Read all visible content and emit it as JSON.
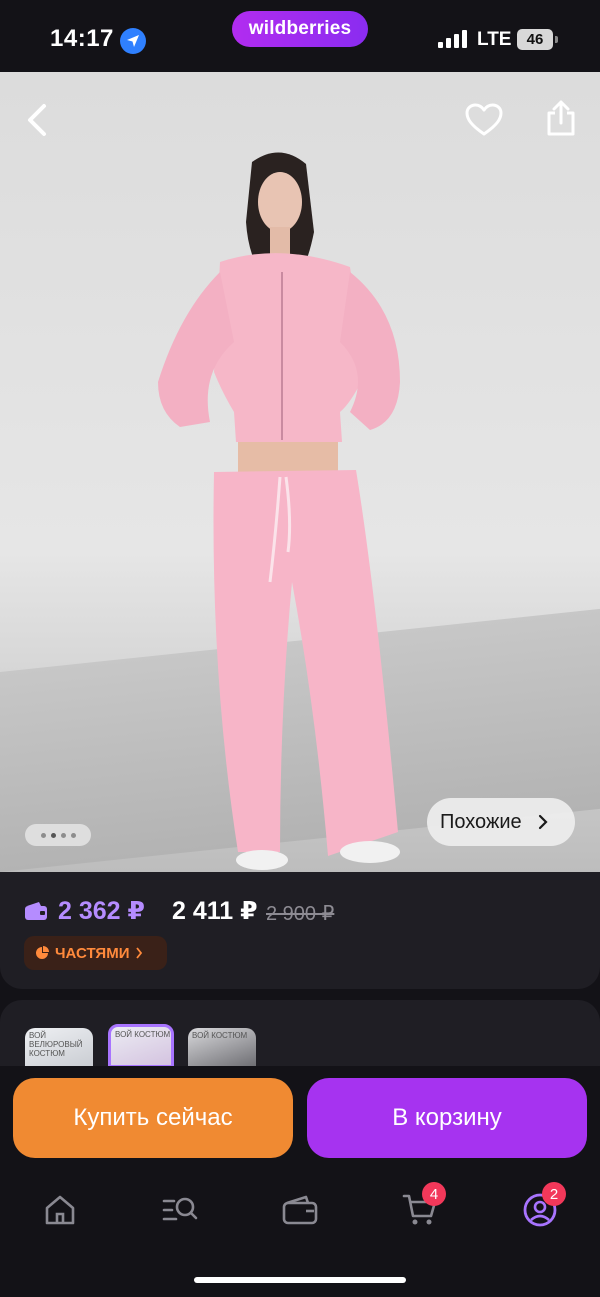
{
  "status_bar": {
    "time": "14:17",
    "brand": "wildberries",
    "network": "LTE",
    "battery": "46"
  },
  "product": {
    "similar_label": "Похожие",
    "gallery_total": 4,
    "gallery_active": 2,
    "wallet_price": "2 362 ₽",
    "price": "2 411 ₽",
    "old_price": "2 900 ₽",
    "installments_label": "ЧАСТЯМИ"
  },
  "thumbnails": [
    {
      "caption": "ВОЙ ВЕЛЮРОВЫЙ КОСТЮМ"
    },
    {
      "caption": "ВОЙ КОСТЮМ"
    },
    {
      "caption": "ВОЙ КОСТЮМ"
    }
  ],
  "actions": {
    "buy_now": "Купить сейчас",
    "add_to_cart": "В корзину"
  },
  "tab_bar": {
    "cart_badge": "4",
    "profile_badge": "2"
  },
  "colors": {
    "accent_purple": "#a633f0",
    "buy_orange": "#f08a32",
    "wallet_price": "#b58cff",
    "installments": "#ff8a3c",
    "badge": "#f2385a"
  }
}
